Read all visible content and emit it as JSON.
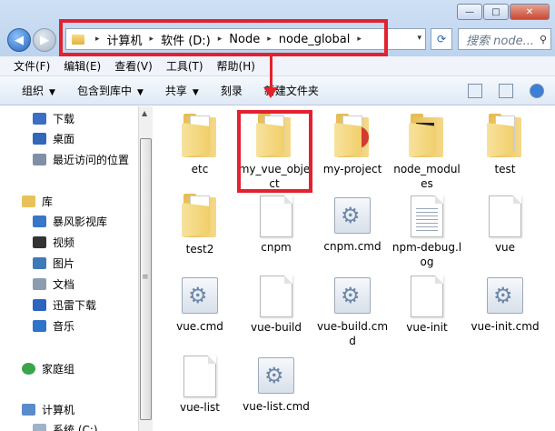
{
  "window": {
    "controls": {
      "minimize": "—",
      "maximize": "□",
      "close": "✕"
    }
  },
  "nav": {
    "back_icon": "arrow-left-icon",
    "forward_icon": "arrow-right-icon"
  },
  "address": {
    "crumbs": [
      "计算机",
      "软件 (D:)",
      "Node",
      "node_global"
    ],
    "separator": "▸",
    "dropdown": "▾",
    "refresh": "⟳"
  },
  "search": {
    "placeholder": "搜索 node...",
    "icon": "🔍"
  },
  "menubar": [
    "文件(F)",
    "编辑(E)",
    "查看(V)",
    "工具(T)",
    "帮助(H)"
  ],
  "cmdbar": {
    "organize": "组织",
    "include_library": "包含到库中",
    "share": "共享",
    "burn": "刻录",
    "new_folder": "新建文件夹"
  },
  "sidebar": {
    "favorites": [
      {
        "label": "下载",
        "icon": "download-icon",
        "color": "#3b6fc4"
      },
      {
        "label": "桌面",
        "icon": "desktop-icon",
        "color": "#2f69b8"
      },
      {
        "label": "最近访问的位置",
        "icon": "recent-places-icon",
        "color": "#7f8fa6"
      }
    ],
    "library": {
      "label": "库",
      "icon": "library-icon"
    },
    "libraries": [
      {
        "label": "暴风影视库",
        "icon": "video-library-icon",
        "color": "#3876c8"
      },
      {
        "label": "视频",
        "icon": "video-icon",
        "color": "#333333"
      },
      {
        "label": "图片",
        "icon": "pictures-icon",
        "color": "#3e7ab8"
      },
      {
        "label": "文档",
        "icon": "documents-icon",
        "color": "#8c9cb0"
      },
      {
        "label": "迅雷下载",
        "icon": "thunder-download-icon",
        "color": "#2c64c0"
      },
      {
        "label": "音乐",
        "icon": "music-icon",
        "color": "#2f74c8"
      }
    ],
    "homegroup": {
      "label": "家庭组",
      "icon": "homegroup-icon"
    },
    "computer": {
      "label": "计算机",
      "icon": "computer-icon"
    },
    "system": {
      "label": "系统 (C:)",
      "icon": "drive-icon"
    }
  },
  "files": [
    {
      "name": "etc",
      "type": "folder"
    },
    {
      "name": "my_vue_object",
      "type": "folder"
    },
    {
      "name": "my-project",
      "type": "folder-red"
    },
    {
      "name": "node_modules",
      "type": "folder-dark"
    },
    {
      "name": "test",
      "type": "folder"
    },
    {
      "name": "test2",
      "type": "folder"
    },
    {
      "name": "cnpm",
      "type": "file"
    },
    {
      "name": "cnpm.cmd",
      "type": "cmd"
    },
    {
      "name": "npm-debug.log",
      "type": "log"
    },
    {
      "name": "vue",
      "type": "file"
    },
    {
      "name": "vue.cmd",
      "type": "cmd"
    },
    {
      "name": "vue-build",
      "type": "file"
    },
    {
      "name": "vue-build.cmd",
      "type": "cmd"
    },
    {
      "name": "vue-init",
      "type": "file"
    },
    {
      "name": "vue-init.cmd",
      "type": "cmd"
    },
    {
      "name": "vue-list",
      "type": "file"
    },
    {
      "name": "vue-list.cmd",
      "type": "cmd"
    }
  ],
  "colors": {
    "highlight": "#e3212f",
    "accent": "#2a62b4"
  }
}
